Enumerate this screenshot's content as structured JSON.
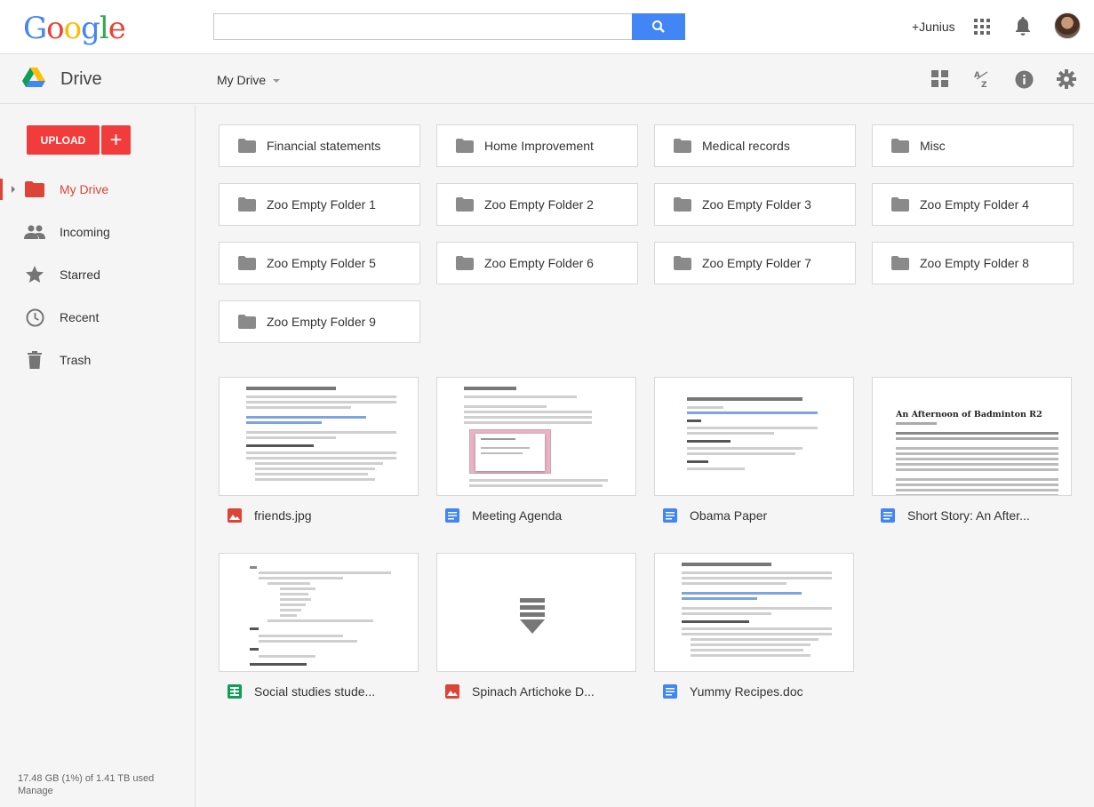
{
  "header": {
    "logo_text": "Google",
    "search": {
      "value": "",
      "placeholder": ""
    },
    "user": "+Junius"
  },
  "drivebar": {
    "app_title": "Drive",
    "breadcrumb": "My Drive"
  },
  "sidebar": {
    "upload_label": "UPLOAD",
    "new_label": "+",
    "items": [
      {
        "label": "My Drive",
        "icon": "folder-icon",
        "active": true
      },
      {
        "label": "Incoming",
        "icon": "people-icon"
      },
      {
        "label": "Starred",
        "icon": "star-icon"
      },
      {
        "label": "Recent",
        "icon": "clock-icon"
      },
      {
        "label": "Trash",
        "icon": "trash-icon"
      }
    ],
    "storage": "17.48 GB (1%) of 1.41 TB used",
    "manage": "Manage"
  },
  "folders": [
    "Financial statements",
    "Home Improvement",
    "Medical records",
    "Misc",
    "Zoo Empty Folder 1",
    "Zoo Empty Folder 2",
    "Zoo Empty Folder 3",
    "Zoo Empty Folder 4",
    "Zoo Empty Folder 5",
    "Zoo Empty Folder 6",
    "Zoo Empty Folder 7",
    "Zoo Empty Folder 8",
    "Zoo Empty Folder 9"
  ],
  "files": [
    {
      "name": "friends.jpg",
      "type": "image",
      "thumb_title": "Project Structure Prevents Component Reuse"
    },
    {
      "name": "Meeting Agenda",
      "type": "doc",
      "thumb_title": "Sync menu UI tweaks"
    },
    {
      "name": "Obama Paper",
      "type": "doc",
      "thumb_title": "Sync client upgrade authentication wording"
    },
    {
      "name": "Short Story: An After...",
      "type": "doc",
      "thumb_title": "An Afternoon of Badminton R2"
    },
    {
      "name": "Social studies stude...",
      "type": "sheet",
      "thumb_title": ""
    },
    {
      "name": "Spinach Artichoke D...",
      "type": "image",
      "thumb_title": ""
    },
    {
      "name": "Yummy Recipes.doc",
      "type": "doc",
      "thumb_title": "Project Structure Prevents Component Reuse"
    }
  ],
  "colors": {
    "accent_red": "#db4437",
    "upload_red": "#f23c3c",
    "search_blue": "#4285f4",
    "doc_blue": "#4285f4",
    "sheet_green": "#0f9d58"
  }
}
